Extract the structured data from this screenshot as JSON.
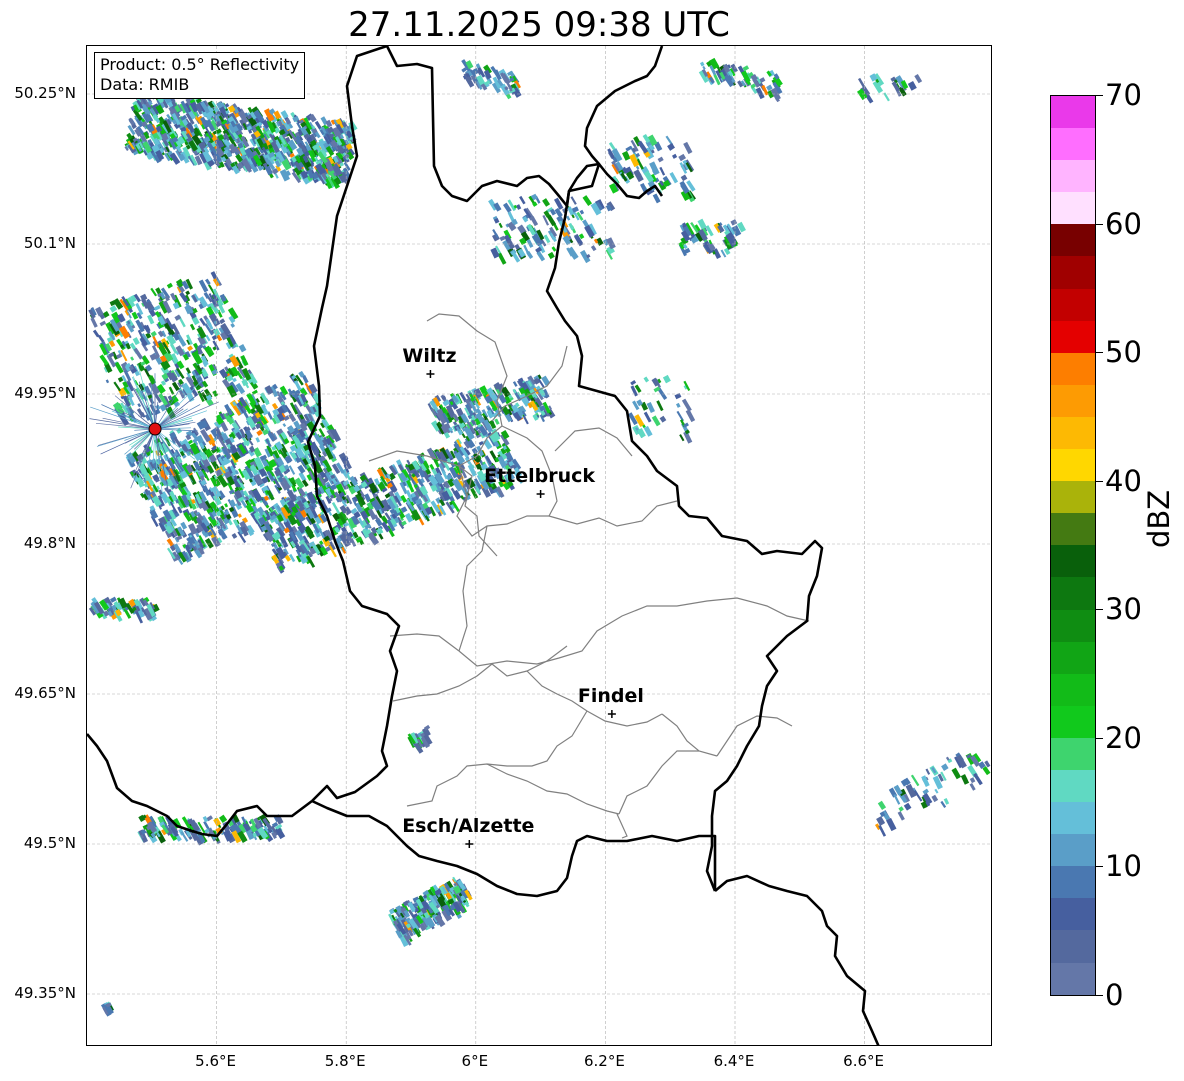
{
  "title": "27.11.2025 09:38 UTC",
  "info_box": {
    "product": "Product: 0.5° Reflectivity",
    "data": "Data: RMIB"
  },
  "latitude_labels": [
    "50.25°N",
    "50.1°N",
    "49.95°N",
    "49.8°N",
    "49.65°N",
    "49.5°N",
    "49.35°N"
  ],
  "longitude_labels": [
    "5.6°E",
    "5.8°E",
    "6°E",
    "6.2°E",
    "6.4°E",
    "6.6°E"
  ],
  "cities": [
    {
      "name": "Wiltz",
      "lon": 5.93,
      "lat": 49.97
    },
    {
      "name": "Ettelbruck",
      "lon": 6.1,
      "lat": 49.85
    },
    {
      "name": "Findel",
      "lon": 6.21,
      "lat": 49.63
    },
    {
      "name": "Esch/Alzette",
      "lon": 5.99,
      "lat": 49.5
    }
  ],
  "radar_site": {
    "lon": 5.505,
    "lat": 49.915,
    "color": "#e01010"
  },
  "colorbar": {
    "label": "dBZ",
    "ticks": [
      "0",
      "10",
      "20",
      "30",
      "40",
      "50",
      "60",
      "70"
    ],
    "colors": [
      "#6477a8",
      "#54699e",
      "#465f9f",
      "#4a78b1",
      "#5a9ec8",
      "#64bfd9",
      "#60d9c2",
      "#3ed46e",
      "#11c91c",
      "#12bb18",
      "#11a515",
      "#0f8d12",
      "#0d7810",
      "#09600b",
      "#447a12",
      "#aab30a",
      "#ffd700",
      "#fdb903",
      "#fd9b03",
      "#fd7e00",
      "#e40000",
      "#c20000",
      "#a00000",
      "#780000",
      "#ffe0ff",
      "#ffb4ff",
      "#ff6eff",
      "#ea39ea"
    ]
  },
  "colors": {
    "country_border": "#000000",
    "canton_border": "#808080",
    "grid": "#b0b0b0"
  }
}
